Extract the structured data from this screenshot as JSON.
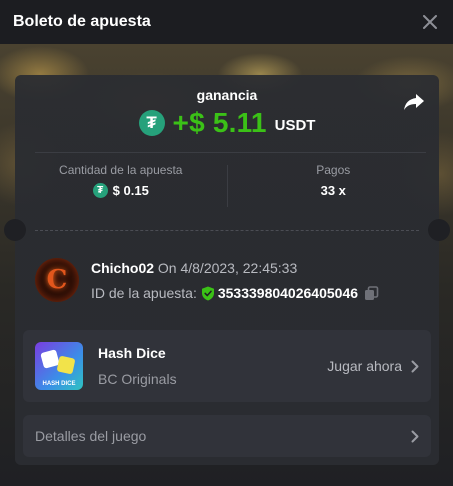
{
  "header": {
    "title": "Boleto de apuesta"
  },
  "profit": {
    "label": "ganancia",
    "amount": "+$ 5.11",
    "currency": "USDT",
    "coin_symbol": "₮"
  },
  "stats": {
    "bet_amount_label": "Cantidad de la apuesta",
    "bet_amount_value": "$ 0.15",
    "payout_label": "Pagos",
    "payout_value": "33 x"
  },
  "player": {
    "avatar_letter": "C",
    "name": "Chicho02",
    "time": "On 4/8/2023, 22:45:33",
    "bet_id_label": "ID de la apuesta:",
    "bet_id": "353339804026405046"
  },
  "game": {
    "name": "Hash Dice",
    "provider": "BC Originals",
    "play_label": "Jugar ahora",
    "thumb_text": "HASH DICE"
  },
  "details": {
    "label": "Detalles del juego"
  },
  "colors": {
    "profit_green": "#3bc117",
    "usdt_teal": "#26a17b",
    "verified_green": "#3bc117"
  }
}
